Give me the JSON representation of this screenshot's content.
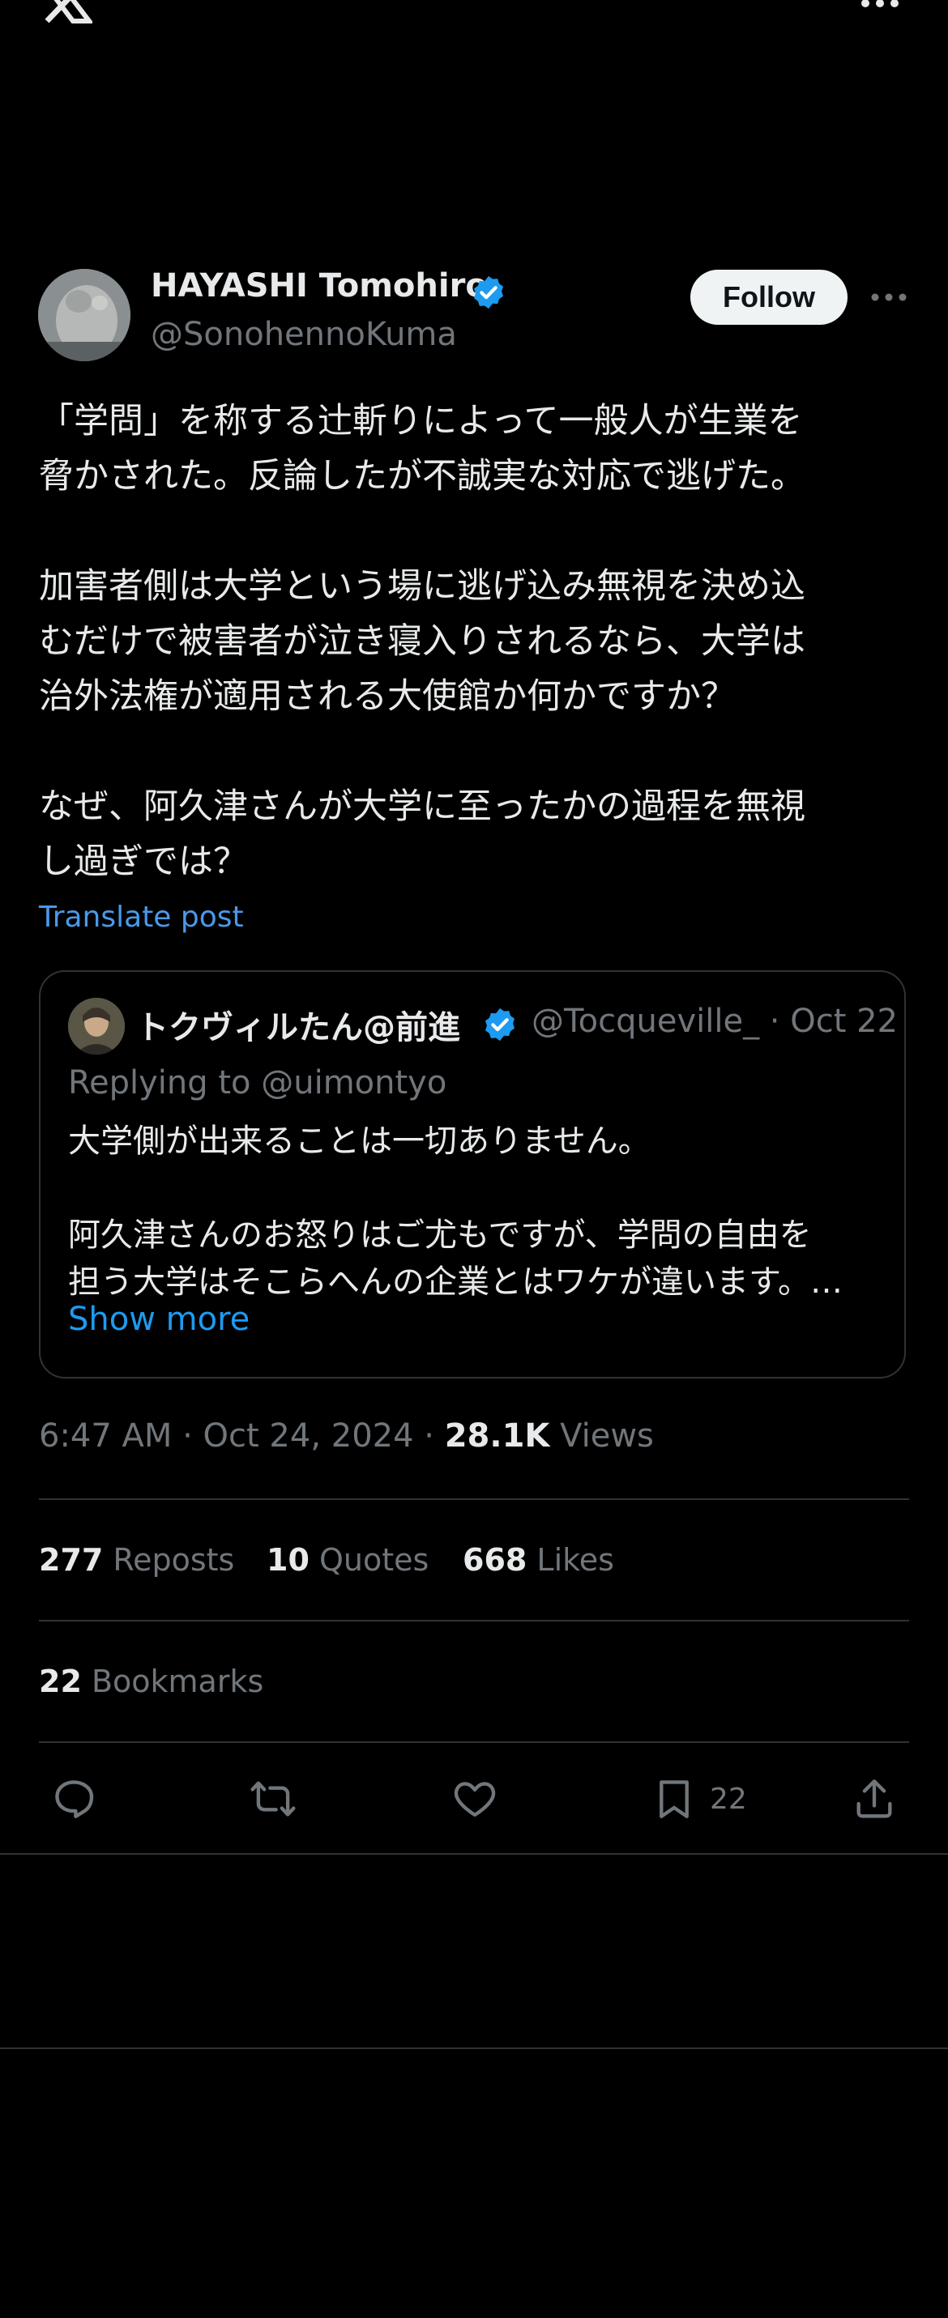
{
  "author": {
    "name": "HAYASHI Tomohiro",
    "handle": "@SonohennoKuma"
  },
  "follow_label": "Follow",
  "post": {
    "lines": [
      "「学問」を称する辻斬りによって一般人が生業を",
      "脅かされた。反論したが不誠実な対応で逃げた。",
      "",
      "加害者側は大学という場に逃げ込み無視を決め込",
      "むだけで被害者が泣き寝入りされるなら、大学は",
      "治外法権が適用される大使館か何かですか？",
      "",
      "なぜ、阿久津さんが大学に至ったかの過程を無視",
      "し過ぎでは？"
    ],
    "translate_label": "Translate post"
  },
  "quote": {
    "name": "トクヴィルたん@前進",
    "handle": "@Tocqueville_",
    "separator": "·",
    "date": "Oct 22",
    "replying": "Replying to @uimontyo",
    "lines": [
      "大学側が出来ることは一切ありません。",
      "",
      "阿久津さんのお怒りはご尤もですが、学問の自由を",
      "担う大学はそこらへんの企業とはワケが違います。…"
    ],
    "show_more": "Show more"
  },
  "meta": {
    "time": "6:47 AM · Oct 24, 2024 · ",
    "views_count": "28.1K",
    "views_label": " Views"
  },
  "stats": {
    "reposts_count": "277",
    "reposts_label": " Reposts",
    "quotes_count": "10",
    "quotes_label": " Quotes",
    "likes_count": "668",
    "likes_label": " Likes",
    "bookmarks_count": "22",
    "bookmarks_label": " Bookmarks"
  },
  "actions": {
    "bookmark_count": "22"
  },
  "colors": {
    "background": "#000000",
    "text": "#e7e9ea",
    "secondary": "#71767b",
    "accent": "#1d9bf0",
    "divider": "#2f3336"
  },
  "icons": [
    "x-logo-icon",
    "more-icon",
    "verified-badge-icon",
    "reply-icon",
    "repost-icon",
    "like-icon",
    "bookmark-icon",
    "share-icon"
  ]
}
